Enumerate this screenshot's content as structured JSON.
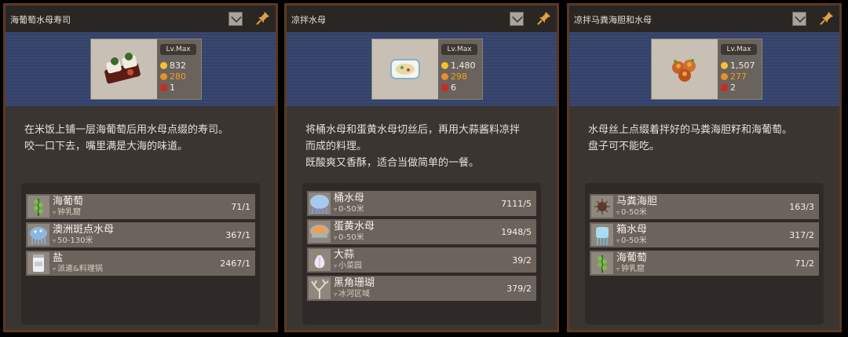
{
  "panels": [
    {
      "title": "海葡萄水母寿司",
      "level": "Lv.Max",
      "stats": [
        "832",
        "280",
        "1"
      ],
      "description": [
        "在米饭上铺一层海葡萄后用水母点缀的寿司。",
        "咬一口下去，嘴里满是大海的味道。"
      ],
      "ingredients": [
        {
          "name": "海葡萄",
          "location": "钟乳窟",
          "count": "71/1",
          "icon": "sea-grape-icon"
        },
        {
          "name": "澳洲斑点水母",
          "location": "50-130米",
          "count": "367/1",
          "icon": "spotted-jellyfish-icon"
        },
        {
          "name": "盐",
          "location": "派遣&料理锅",
          "count": "2467/1",
          "icon": "salt-jar-icon"
        }
      ]
    },
    {
      "title": "凉拌水母",
      "level": "Lv.Max",
      "stats": [
        "1,480",
        "298",
        "6"
      ],
      "description": [
        "将桶水母和蛋黄水母切丝后，再用大蒜酱料凉拌",
        "而成的料理。",
        "既酸爽又香酥，适合当做简单的一餐。"
      ],
      "ingredients": [
        {
          "name": "桶水母",
          "location": "0-50米",
          "count": "7111/5",
          "icon": "barrel-jellyfish-icon"
        },
        {
          "name": "蛋黄水母",
          "location": "0-50米",
          "count": "1948/5",
          "icon": "egg-yolk-jellyfish-icon"
        },
        {
          "name": "大蒜",
          "location": "小菜园",
          "count": "39/2",
          "icon": "garlic-icon"
        },
        {
          "name": "黑角珊瑚",
          "location": "冰河区域",
          "count": "379/2",
          "icon": "black-coral-icon"
        }
      ]
    },
    {
      "title": "凉拌马粪海胆和水母",
      "level": "Lv.Max",
      "stats": [
        "1,507",
        "277",
        "2"
      ],
      "description": [
        "水母丝上点缀着拌好的马粪海胆籽和海葡萄。",
        "盘子可不能吃。"
      ],
      "ingredients": [
        {
          "name": "马粪海胆",
          "location": "0-50米",
          "count": "163/3",
          "icon": "sea-urchin-icon"
        },
        {
          "name": "箱水母",
          "location": "0-50米",
          "count": "317/2",
          "icon": "box-jellyfish-icon"
        },
        {
          "name": "海葡萄",
          "location": "钟乳窟",
          "count": "71/2",
          "icon": "sea-grape-icon"
        }
      ]
    }
  ],
  "colors": {
    "coin": "#f2c230",
    "heart": "#e8902a",
    "pot": "#c0302a",
    "accent_orange": "#f0a020"
  }
}
